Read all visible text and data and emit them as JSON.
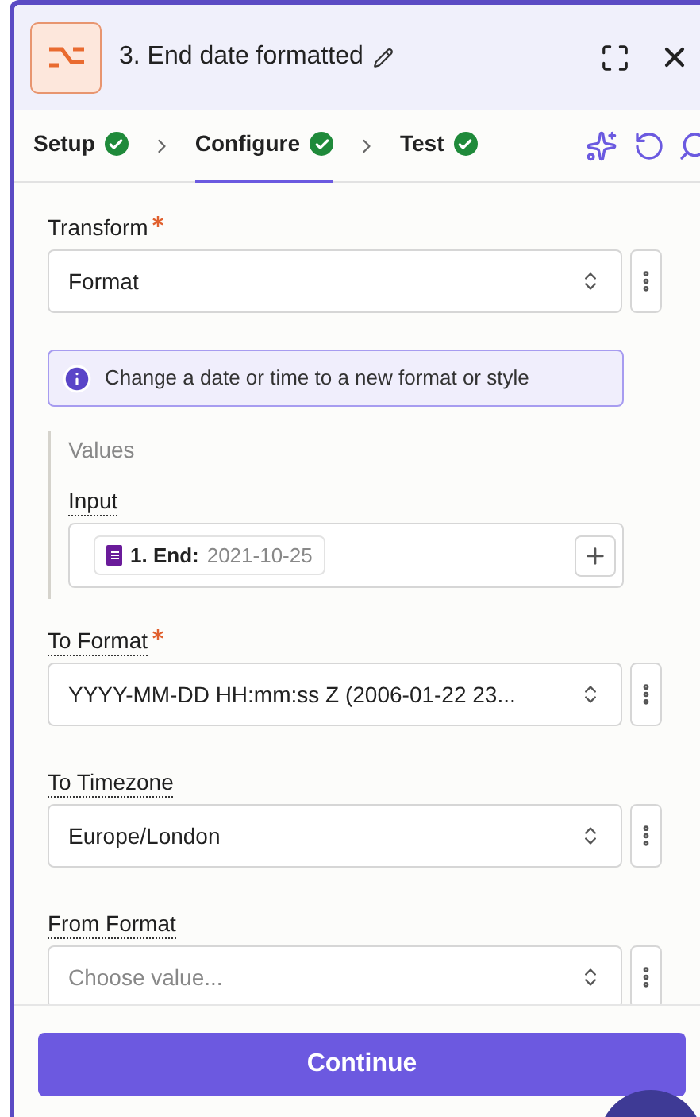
{
  "header": {
    "title": "3. End date formatted"
  },
  "steps": [
    {
      "label": "Setup",
      "done": true,
      "selected": false
    },
    {
      "label": "Configure",
      "done": true,
      "selected": true
    },
    {
      "label": "Test",
      "done": true,
      "selected": false
    }
  ],
  "fields": [
    {
      "kind": "select",
      "label": "Transform",
      "required": true,
      "help": false,
      "value": "Format"
    },
    {
      "kind": "info",
      "text": "Change a date or time to a new format or style"
    },
    {
      "kind": "group",
      "title": "Values",
      "fields": [
        {
          "label": "Input",
          "required": false,
          "help": true,
          "chip_label": "1. End:",
          "chip_value": "2021-10-25"
        }
      ]
    },
    {
      "kind": "select",
      "label": "To Format",
      "required": true,
      "help": true,
      "value": "YYYY-MM-DD HH:mm:ss Z (2006-01-22 23..."
    },
    {
      "kind": "select",
      "label": "To Timezone",
      "required": false,
      "help": true,
      "value": "Europe/London"
    },
    {
      "kind": "select",
      "label": "From Format",
      "required": false,
      "help": true,
      "placeholder": "Choose value..."
    }
  ],
  "footer": {
    "button": "Continue"
  }
}
